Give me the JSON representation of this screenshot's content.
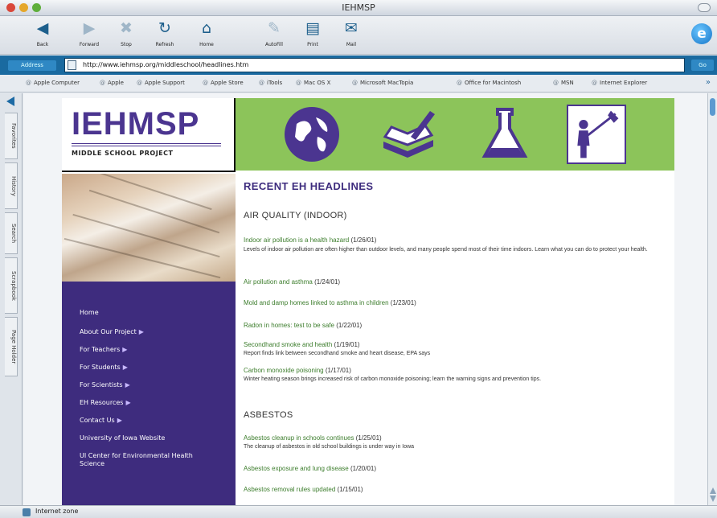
{
  "window": {
    "title": "IEHMSP"
  },
  "toolbar": {
    "buttons": [
      {
        "label": "Back",
        "icon": "back-arrow-icon"
      },
      {
        "label": "Forward",
        "icon": "forward-arrow-icon"
      },
      {
        "label": "Stop",
        "icon": "stop-icon"
      },
      {
        "label": "Refresh",
        "icon": "refresh-icon"
      },
      {
        "label": "Home",
        "icon": "home-icon"
      },
      {
        "label": "AutoFill",
        "icon": "autofill-icon"
      },
      {
        "label": "Print",
        "icon": "print-icon"
      },
      {
        "label": "Mail",
        "icon": "mail-icon"
      }
    ]
  },
  "address": {
    "label": "Address",
    "url": "http://www.iehmsp.org/middleschool/headlines.htm",
    "go": "Go"
  },
  "favorites": [
    "Apple Computer",
    "Apple",
    "Apple Support",
    "Apple Store",
    "iTools",
    "Mac OS X",
    "Microsoft MacTopia",
    "Office for Macintosh",
    "MSN",
    "Internet Explorer"
  ],
  "sidebar_tabs": [
    "Favorites",
    "History",
    "Search",
    "Scrapbook",
    "Page Holder"
  ],
  "page": {
    "logo": {
      "main": "IEHMSP",
      "sub": "MIDDLE SCHOOL PROJECT"
    },
    "nav": [
      "Home",
      "About Our Project",
      "For Teachers",
      "For Students",
      "For Scientists",
      "EH Resources",
      "Contact Us",
      "University of Iowa Website",
      "UI Center for Environmental Health Science"
    ],
    "headline": "RECENT EH HEADLINES",
    "sections": [
      {
        "title": "AIR QUALITY (INDOOR)",
        "stories": [
          {
            "link": "Indoor air pollution is a health hazard",
            "date": "(1/26/01)",
            "text": "Levels of indoor air pollution are often higher than outdoor levels, and many people spend most of their time indoors. Learn what you can do to protect your health."
          },
          {
            "link": "Air pollution and asthma",
            "date": "(1/24/01)",
            "text": ""
          },
          {
            "link": "Mold and damp homes linked to asthma in children",
            "date": "(1/23/01)",
            "text": ""
          },
          {
            "link": "Radon in homes: test to be safe",
            "date": "(1/22/01)",
            "text": ""
          },
          {
            "link": "Secondhand smoke and health",
            "date": "(1/19/01)",
            "text": "Report finds link between secondhand smoke and heart disease, EPA says"
          },
          {
            "link": "Carbon monoxide poisoning",
            "date": "(1/17/01)",
            "text": "Winter heating season brings increased risk of carbon monoxide poisoning; learn the warning signs and prevention tips."
          }
        ]
      },
      {
        "title": "ASBESTOS",
        "stories": [
          {
            "link": "Asbestos cleanup in schools continues",
            "date": "(1/25/01)",
            "text": "The cleanup of asbestos in old school buildings is under way in Iowa"
          },
          {
            "link": "Asbestos exposure and lung disease",
            "date": "(1/20/01)",
            "text": ""
          },
          {
            "link": "Asbestos removal rules updated",
            "date": "(1/15/01)",
            "text": ""
          }
        ]
      }
    ]
  },
  "status": {
    "text": "Internet zone"
  }
}
